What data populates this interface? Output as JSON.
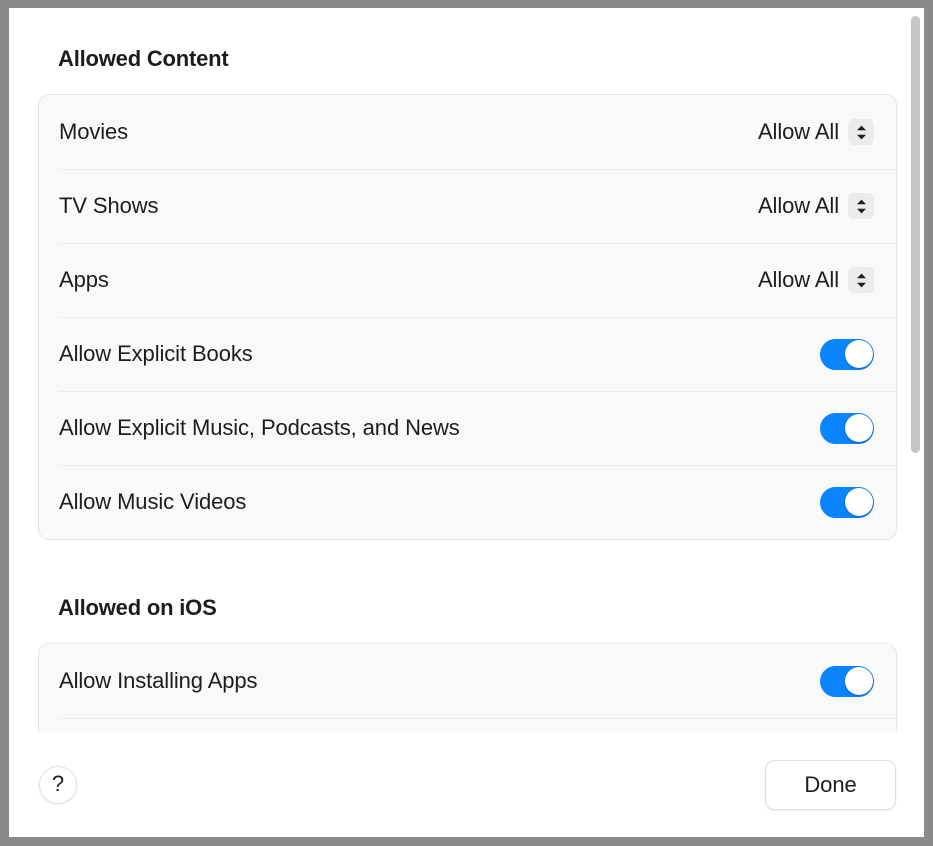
{
  "window": {
    "frame_color": "#8a8a8a",
    "background": "#ffffff"
  },
  "accent_color": "#0a84ff",
  "sections": [
    {
      "heading": "Allowed Content",
      "rows": [
        {
          "label": "Movies",
          "control": "popup",
          "value": "Allow All"
        },
        {
          "label": "TV Shows",
          "control": "popup",
          "value": "Allow All"
        },
        {
          "label": "Apps",
          "control": "popup",
          "value": "Allow All"
        },
        {
          "label": "Allow Explicit Books",
          "control": "switch",
          "value": "on"
        },
        {
          "label": "Allow Explicit Music, Podcasts, and News",
          "control": "switch",
          "value": "on"
        },
        {
          "label": "Allow Music Videos",
          "control": "switch",
          "value": "on"
        }
      ]
    },
    {
      "heading": "Allowed on iOS",
      "rows": [
        {
          "label": "Allow Installing Apps",
          "control": "switch",
          "value": "on"
        }
      ]
    }
  ],
  "scrollbar": {
    "orientation": "vertical",
    "thumb_color": "#c6c6c6"
  },
  "toolbar": {
    "help_label": "?",
    "done_label": "Done"
  },
  "icons": {
    "stepper": "chevron-up-down-icon",
    "help": "question-mark-icon"
  }
}
